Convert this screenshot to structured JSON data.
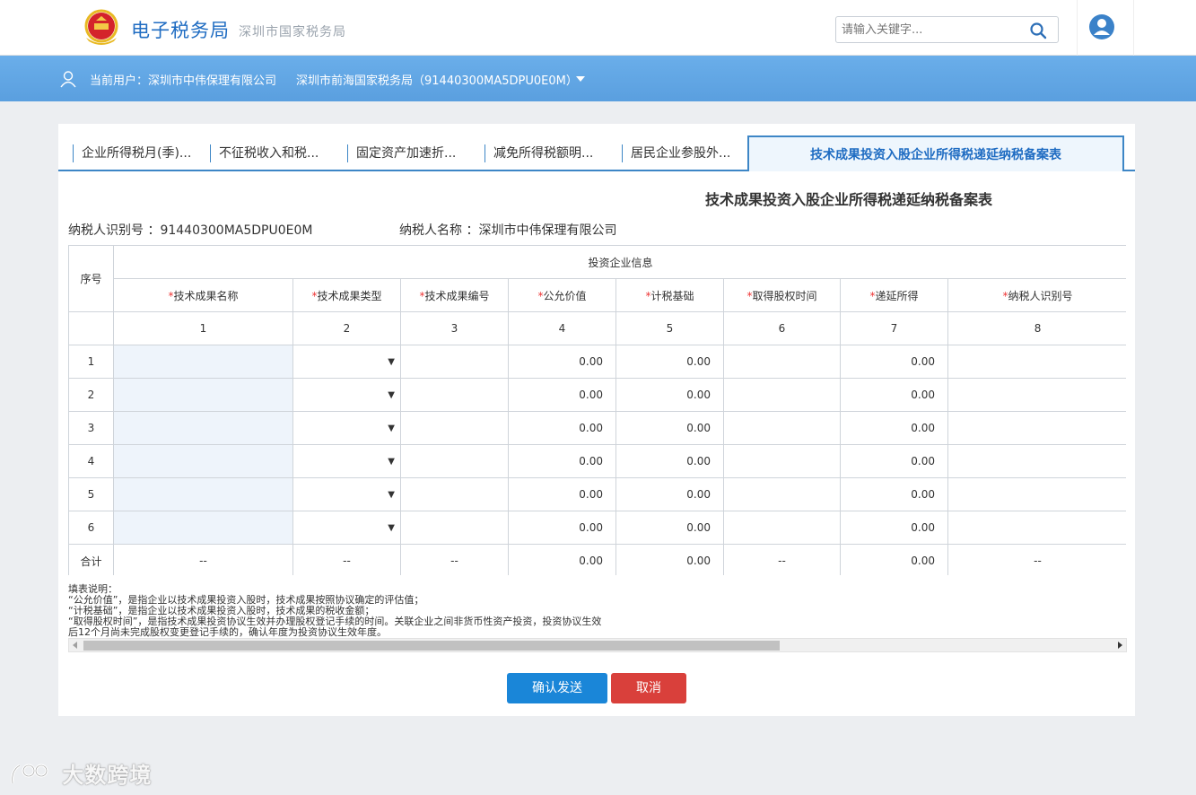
{
  "header": {
    "title": "电子税务局",
    "subtitle": "深圳市国家税务局",
    "search_placeholder": "请输入关键字..."
  },
  "userbar": {
    "current_user": "当前用户：深圳市中伟保理有限公司",
    "tax_office": "深圳市前海国家税务局（91440300MA5DPU0E0M）"
  },
  "tabs": [
    {
      "label": "企业所得税月(季)..."
    },
    {
      "label": "不征税收入和税..."
    },
    {
      "label": "固定资产加速折..."
    },
    {
      "label": "减免所得税额明..."
    },
    {
      "label": "居民企业参股外..."
    },
    {
      "label": "技术成果投资入股企业所得税递延纳税备案表",
      "active": true
    }
  ],
  "form": {
    "title": "技术成果投资入股企业所得税递延纳税备案表",
    "taxpayer_id": "纳税人识别号 ：91440300MA5DPU0E0M",
    "taxpayer_name": "纳税人名称 ：深圳市中伟保理有限公司"
  },
  "table": {
    "seq_header": "序号",
    "group_header": "投资企业信息",
    "columns": [
      "技术成果名称",
      "技术成果类型",
      "技术成果编号",
      "公允价值",
      "计税基础",
      "取得股权时间",
      "递延所得",
      "纳税人识别号"
    ],
    "column_numbers": [
      "1",
      "2",
      "3",
      "4",
      "5",
      "6",
      "7",
      "8"
    ],
    "required_mark": "*",
    "rows": [
      {
        "seq": "1",
        "fair_value": "0.00",
        "tax_basis": "0.00",
        "deferred": "0.00"
      },
      {
        "seq": "2",
        "fair_value": "0.00",
        "tax_basis": "0.00",
        "deferred": "0.00"
      },
      {
        "seq": "3",
        "fair_value": "0.00",
        "tax_basis": "0.00",
        "deferred": "0.00"
      },
      {
        "seq": "4",
        "fair_value": "0.00",
        "tax_basis": "0.00",
        "deferred": "0.00"
      },
      {
        "seq": "5",
        "fair_value": "0.00",
        "tax_basis": "0.00",
        "deferred": "0.00"
      },
      {
        "seq": "6",
        "fair_value": "0.00",
        "tax_basis": "0.00",
        "deferred": "0.00"
      }
    ],
    "dropdown_glyph": "▼",
    "total": {
      "label": "合计",
      "name": "--",
      "type": "--",
      "code": "--",
      "fair_value": "0.00",
      "tax_basis": "0.00",
      "equity_time": "--",
      "deferred": "0.00",
      "taxpayer_id": "--"
    }
  },
  "notes": [
    "填表说明：",
    "“公允价值”，是指企业以技术成果投资入股时，技术成果按照协议确定的评估值；",
    "“计税基础”，是指企业以技术成果投资入股时，技术成果的税收金额；",
    "“取得股权时间”，是指技术成果投资协议生效并办理股权登记手续的时间。关联企业之间非货币性资产投资，投资协议生效",
    "后12个月尚未完成股权变更登记手续的，确认年度为投资协议生效年度。"
  ],
  "buttons": {
    "confirm": "确认发送",
    "cancel": "取消"
  },
  "watermark": "大数跨境",
  "colors": {
    "brand_blue": "#1f6cc2",
    "userbar_blue": "#5fa4e3",
    "confirm_blue": "#1a86d8",
    "cancel_red": "#d9403b",
    "required_red": "#e33333"
  }
}
